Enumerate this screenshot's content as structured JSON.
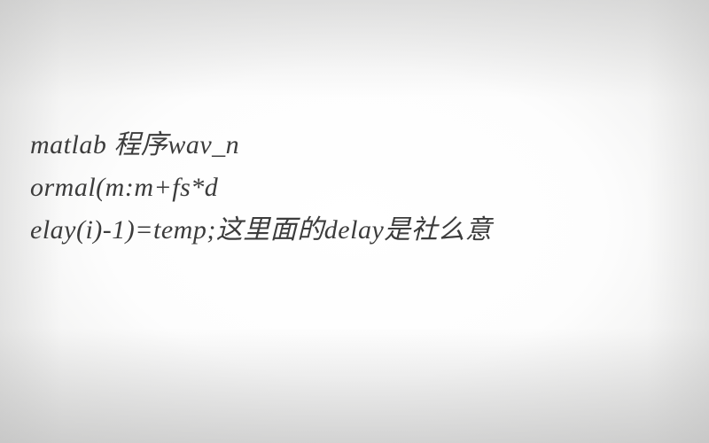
{
  "line1": "matlab 程序wav_n",
  "line2": "ormal(m:m+fs*d",
  "line3": "elay(i)-1)=temp;这里面的delay是社么意"
}
